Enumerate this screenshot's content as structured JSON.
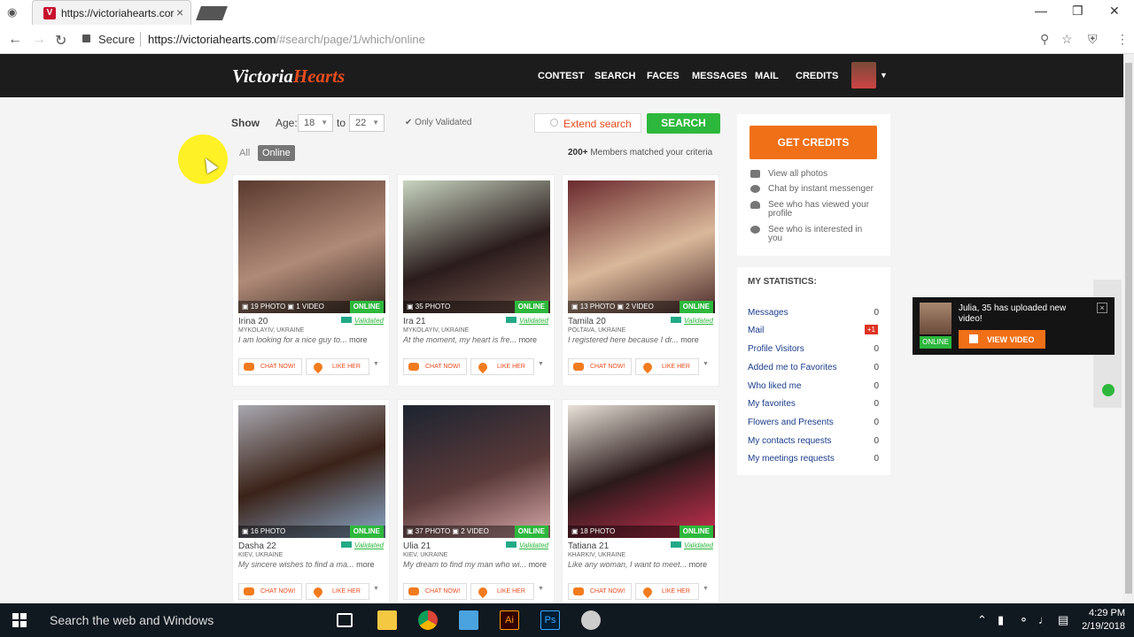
{
  "browser": {
    "tab_title": "https://victoriahearts.cor",
    "secure_label": "Secure",
    "url_main": "https://victoriahearts.com",
    "url_rest": "/#search/page/1/which/online"
  },
  "site": {
    "logo_a": "Victoria",
    "logo_b": "Hearts",
    "nav": [
      "CONTEST",
      "SEARCH",
      "FACES",
      "MESSAGES",
      "MAIL",
      "CREDITS"
    ]
  },
  "filters": {
    "show_label": "Show",
    "age_label": "Age:",
    "age_from": "18",
    "to_label": "to",
    "age_to": "22",
    "only_validated": "Only Validated",
    "extend_search": "Extend search",
    "search_btn": "SEARCH",
    "tab_all": "All",
    "tab_online": "Online",
    "matched_count": "200+",
    "matched_text": "Members matched your criteria"
  },
  "cards": [
    {
      "photos": "19 PHOTO",
      "videos": "1 VIDEO",
      "online": "ONLINE",
      "name": "Irina",
      "age": "20",
      "validated": "Validated",
      "location": "MYKOLAYIV, UKRAINE",
      "desc": "I am looking for a nice guy to...",
      "more": "more",
      "chat": "CHAT NOW!",
      "like": "LIKE HER"
    },
    {
      "photos": "35 PHOTO",
      "videos": "",
      "online": "ONLINE",
      "name": "Ira",
      "age": "21",
      "validated": "Validated",
      "location": "MYKOLAYIV, UKRAINE",
      "desc": "At the moment, my heart is fre...",
      "more": "more",
      "chat": "CHAT NOW!",
      "like": "LIKE HER"
    },
    {
      "photos": "13 PHOTO",
      "videos": "2 VIDEO",
      "online": "ONLINE",
      "name": "Tamila",
      "age": "20",
      "validated": "Validated",
      "location": "POLTAVA, UKRAINE",
      "desc": "I registered here because I dr...",
      "more": "more",
      "chat": "CHAT NOW!",
      "like": "LIKE HER"
    },
    {
      "photos": "16 PHOTO",
      "videos": "",
      "online": "ONLINE",
      "name": "Dasha",
      "age": "22",
      "validated": "Validated",
      "location": "KIEV, UKRAINE",
      "desc": "My sincere wishes to find a ma...",
      "more": "more",
      "chat": "CHAT NOW!",
      "like": "LIKE HER"
    },
    {
      "photos": "37 PHOTO",
      "videos": "2 VIDEO",
      "online": "ONLINE",
      "name": "Ulia",
      "age": "21",
      "validated": "Validated",
      "location": "KIEV, UKRAINE",
      "desc": "My dream to find my man who wi...",
      "more": "more",
      "chat": "CHAT NOW!",
      "like": "LIKE HER"
    },
    {
      "photos": "18 PHOTO",
      "videos": "",
      "online": "ONLINE",
      "name": "Tatiana",
      "age": "21",
      "validated": "Validated",
      "location": "KHARKIV, UKRAINE",
      "desc": "Like any woman, I want to meet...",
      "more": "more",
      "chat": "CHAT NOW!",
      "like": "LIKE HER"
    }
  ],
  "sidebar": {
    "get_credits": "GET CREDITS",
    "links": [
      "View all photos",
      "Chat by instant messenger",
      "See who has viewed your profile",
      "See who is interested in you"
    ],
    "stats_title": "MY STATISTICS:",
    "stats": [
      {
        "label": "Messages",
        "value": "0"
      },
      {
        "label": "Mail",
        "value": "+1"
      },
      {
        "label": "Profile Visitors",
        "value": "0"
      },
      {
        "label": "Added me to Favorites",
        "value": "0"
      },
      {
        "label": "Who liked me",
        "value": "0"
      },
      {
        "label": "My favorites",
        "value": "0"
      },
      {
        "label": "Flowers and Presents",
        "value": "0"
      },
      {
        "label": "My contacts requests",
        "value": "0"
      },
      {
        "label": "My meetings requests",
        "value": "0"
      }
    ]
  },
  "toast": {
    "message": "Julia, 35 has uploaded new video!",
    "online": "ONLINE",
    "button": "VIEW VIDEO"
  },
  "taskbar": {
    "search_placeholder": "Search the web and Windows",
    "time": "4:29 PM",
    "date": "2/19/2018"
  },
  "colors": {
    "accent": "#f07017",
    "green": "#2db83d",
    "header": "#1c1c1c"
  }
}
